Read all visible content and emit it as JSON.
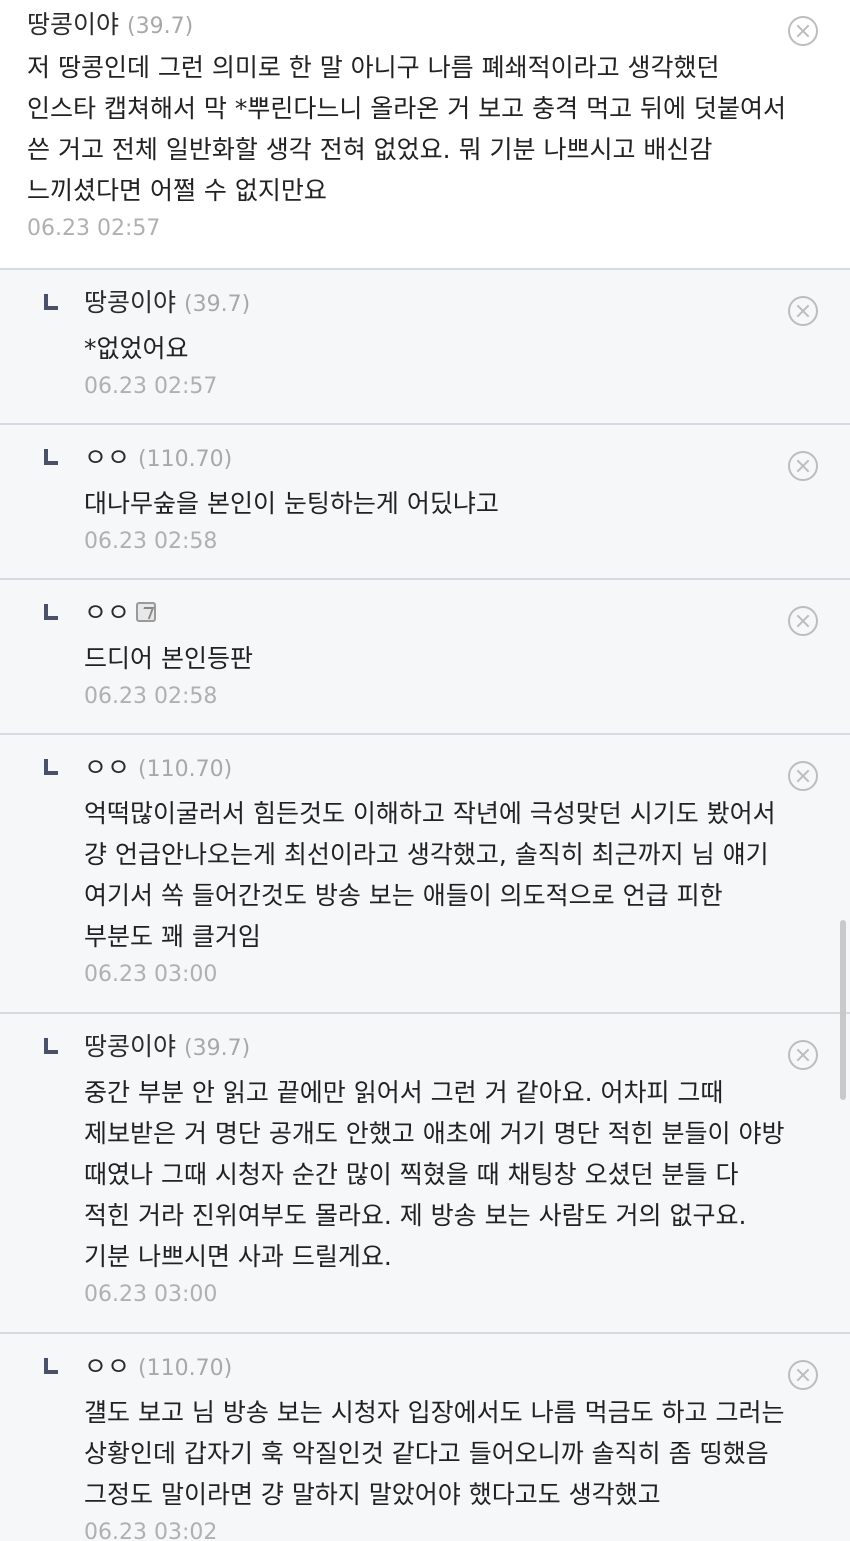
{
  "comments": [
    {
      "nickname": "땅콩이야",
      "ip": "(39.7)",
      "text": "저 땅콩인데 그런 의미로 한 말 아니구 나름 폐쇄적이라고 생각했던 인스타 캡쳐해서 막 *뿌린다느니 올라온 거 보고 충격 먹고 뒤에 덧붙여서 쓴 거고 전체 일반화할 생각 전혀 없었요. 뭐 기분 나쁘시고 배신감 느끼셨다면 어쩔 수 없지만요",
      "time": "06.23 02:57"
    },
    {
      "nickname": "땅콩이야",
      "ip": "(39.7)",
      "text": "*없었어요",
      "time": "06.23 02:57"
    },
    {
      "nickname": "ㅇㅇ",
      "ip": "(110.70)",
      "text": "대나무숲을 본인이 눈팅하는게 어딨냐고",
      "time": "06.23 02:58"
    },
    {
      "nickname": "ㅇㅇ",
      "ip": "",
      "text": "드디어 본인등판",
      "time": "06.23 02:58"
    },
    {
      "nickname": "ㅇㅇ",
      "ip": "(110.70)",
      "text": "억떡많이굴러서 힘든것도 이해하고 작년에 극성맞던 시기도 봤어서 걍 언급안나오는게 최선이라고 생각했고, 솔직히 최근까지 님 얘기 여기서 쏙 들어간것도 방송 보는 애들이 의도적으로 언급 피한 부분도 꽤 클거임",
      "time": "06.23 03:00"
    },
    {
      "nickname": "땅콩이야",
      "ip": "(39.7)",
      "text": "중간 부분 안 읽고 끝에만 읽어서 그런 거 같아요. 어차피 그때 제보받은 거 명단 공개도 안했고 애초에 거기 명단 적힌 분들이 야방 때였나 그때 시청자 순간 많이 찍혔을 때 채팅창 오셨던 분들 다 적힌 거라 진위여부도 몰라요. 제 방송 보는 사람도 거의 없구요. 기분 나쁘시면 사과 드릴게요.",
      "time": "06.23 03:00"
    },
    {
      "nickname": "ㅇㅇ",
      "ip": "(110.70)",
      "text": "걜도 보고 님 방송 보는 시청자 입장에서도 나름 먹금도 하고 그러는 상황인데 갑자기 훅 악질인것 같다고 들어오니까 솔직히 좀 띵했음 그정도 말이라면 걍 말하지 말았어야 했다고도 생각했고",
      "time": "06.23 03:02"
    }
  ],
  "icons": {
    "delete": "circle-x-icon",
    "reply": "reply-arrow-icon",
    "member": "fixed-nick-member-icon"
  }
}
